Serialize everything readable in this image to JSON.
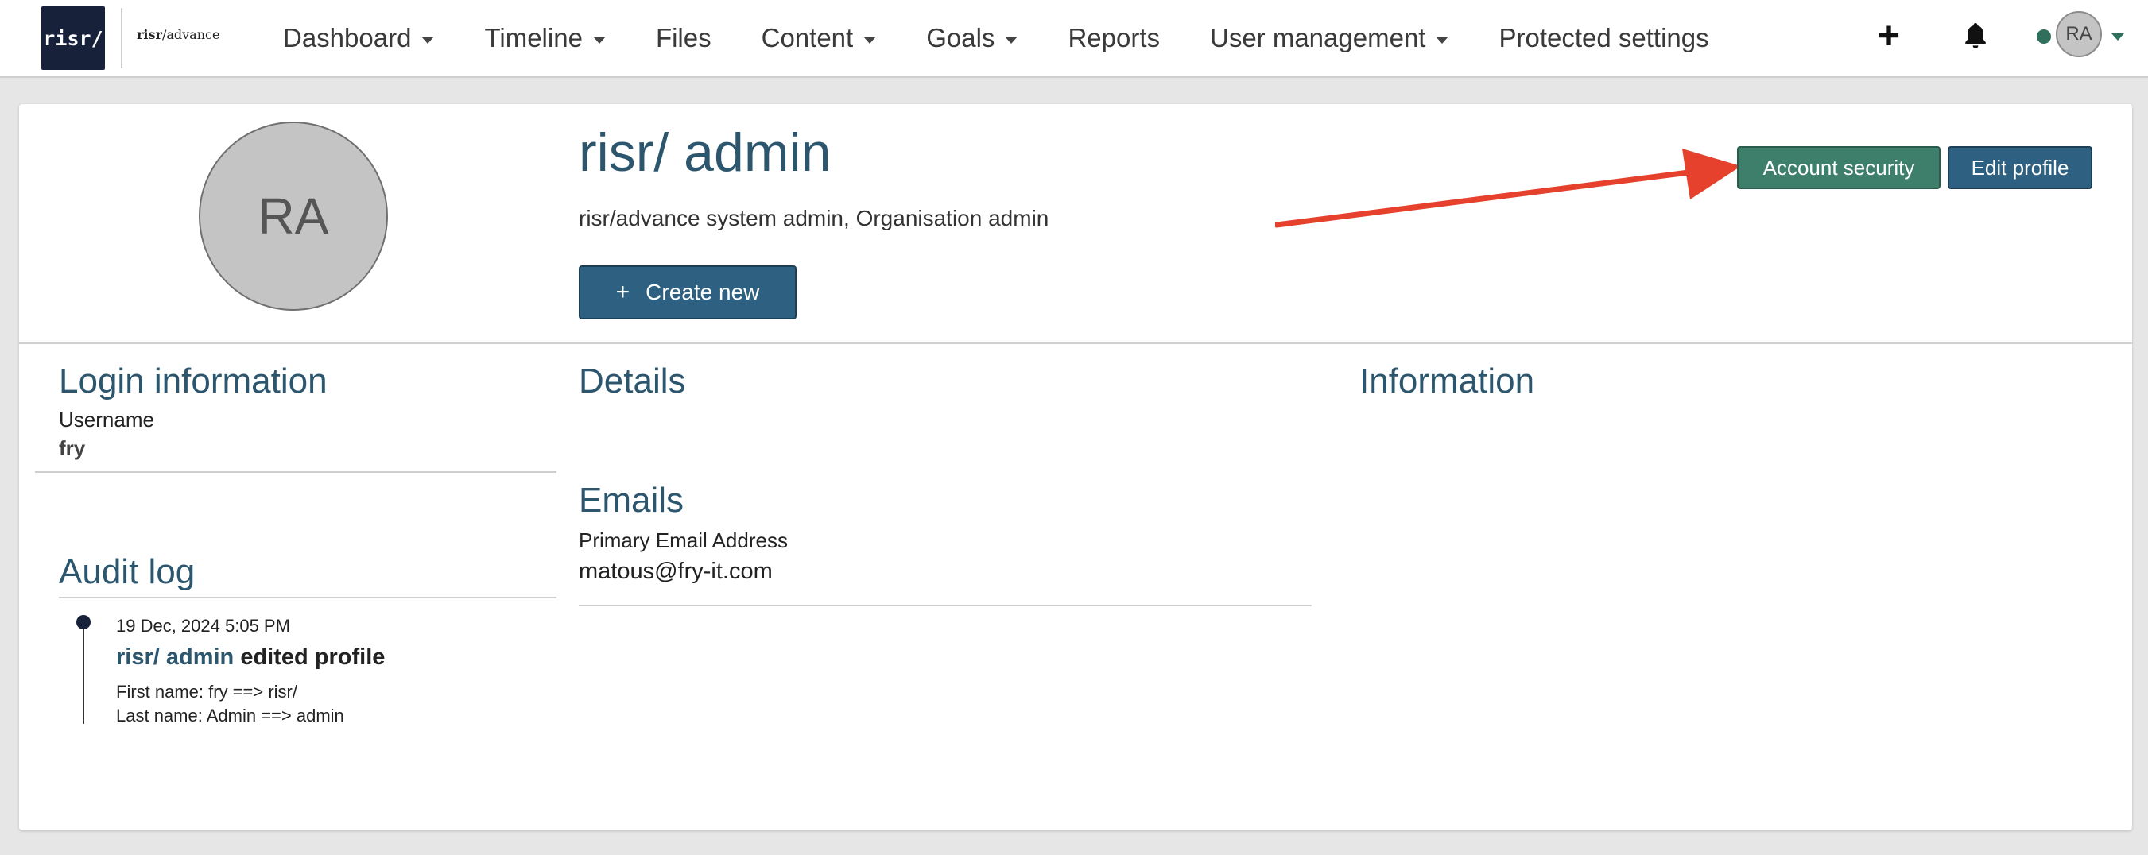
{
  "brand": {
    "logo_mark": "risr/",
    "logo_text_bold": "risr",
    "logo_text_rest": "/advance"
  },
  "nav": {
    "items": [
      {
        "label": "Dashboard",
        "dropdown": true
      },
      {
        "label": "Timeline",
        "dropdown": true
      },
      {
        "label": "Files",
        "dropdown": false
      },
      {
        "label": "Content",
        "dropdown": true
      },
      {
        "label": "Goals",
        "dropdown": true
      },
      {
        "label": "Reports",
        "dropdown": false
      },
      {
        "label": "User management",
        "dropdown": true
      },
      {
        "label": "Protected settings",
        "dropdown": false
      }
    ],
    "add_icon": "plus-icon",
    "notifications_icon": "bell-icon",
    "user_initials": "RA",
    "online_status_color": "#2f6f5b"
  },
  "profile": {
    "initials": "RA",
    "name": "risr/ admin",
    "roles": "risr/advance system admin, Organisation admin",
    "create_new_label": "Create new",
    "account_security_label": "Account security",
    "edit_profile_label": "Edit profile"
  },
  "login_info": {
    "title": "Login information",
    "username_label": "Username",
    "username_value": "fry"
  },
  "details": {
    "title": "Details"
  },
  "emails": {
    "title": "Emails",
    "primary_label": "Primary Email Address",
    "primary_value": "matous@fry-it.com"
  },
  "information": {
    "title": "Information"
  },
  "audit_log": {
    "title": "Audit log",
    "entries": [
      {
        "timestamp": "19 Dec, 2024 5:05 PM",
        "actor": "risr/ admin",
        "action": "edited profile",
        "changes": [
          "First name: fry ==> risr/",
          "Last name: Admin ==> admin"
        ]
      }
    ]
  },
  "colors": {
    "primary": "#2e6181",
    "success": "#3e7f6c",
    "heading": "#2c566d",
    "annotation_arrow": "#e5412d"
  }
}
